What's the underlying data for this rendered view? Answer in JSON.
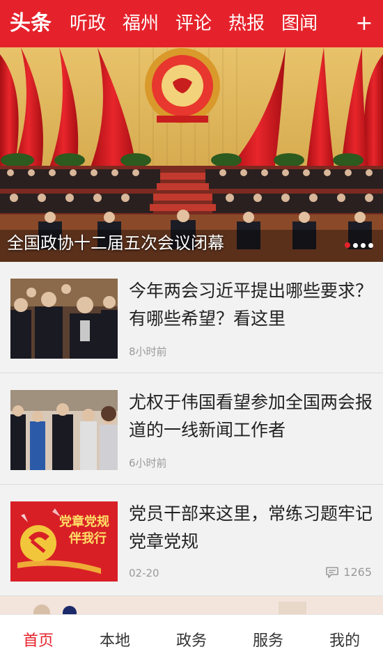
{
  "colors": {
    "brand": "#e5222b",
    "meta_text": "#9a9a9a"
  },
  "top_tabs": [
    {
      "label": "头条",
      "active": true
    },
    {
      "label": "听政",
      "active": false
    },
    {
      "label": "福州",
      "active": false
    },
    {
      "label": "评论",
      "active": false
    },
    {
      "label": "热报",
      "active": false
    },
    {
      "label": "图闻",
      "active": false
    }
  ],
  "add_channel_icon": "plus-icon",
  "hero": {
    "caption": "全国政协十二届五次会议闭幕",
    "slide_count": 4,
    "active_slide": 1
  },
  "news": [
    {
      "title": "今年两会习近平提出哪些要求？有哪些希望？看这里",
      "meta": "8小时前",
      "comments": ""
    },
    {
      "title": "尤权于伟国看望参加全国两会报道的一线新闻工作者",
      "meta": "6小时前",
      "comments": ""
    },
    {
      "title": "党员干部来这里，常练习题牢记党章党规",
      "meta": "02-20",
      "comments": "1265",
      "thumb_text": {
        "line1": "党章党规",
        "line2": "伴我行"
      }
    }
  ],
  "bottom_nav": [
    {
      "label": "首页",
      "active": true
    },
    {
      "label": "本地",
      "active": false
    },
    {
      "label": "政务",
      "active": false
    },
    {
      "label": "服务",
      "active": false
    },
    {
      "label": "我的",
      "active": false
    }
  ]
}
